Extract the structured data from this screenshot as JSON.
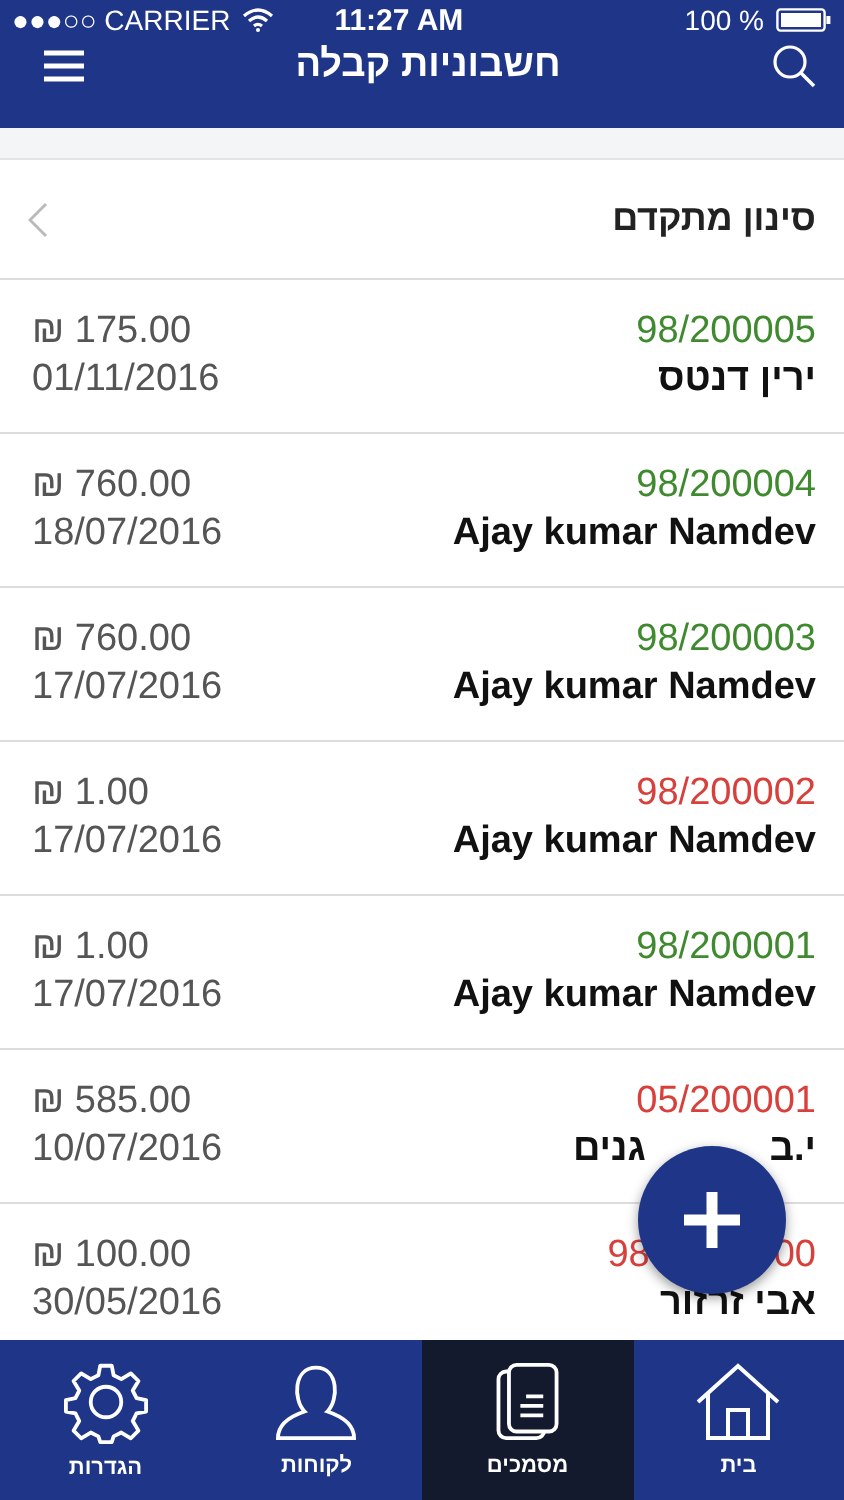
{
  "status_bar": {
    "carrier": "●●●○○ CARRIER",
    "time": "11:27 AM",
    "battery": "100 %"
  },
  "header": {
    "title": "חשבוניות קבלה"
  },
  "filter": {
    "label": "סינון מתקדם"
  },
  "rows": [
    {
      "number_parts": [
        "98/200005"
      ],
      "color": "#3f8a2f",
      "name_parts": [
        "ירין דנטס"
      ],
      "amount": "₪ 175.00",
      "date": "01/11/2016"
    },
    {
      "number_parts": [
        "98/200004"
      ],
      "color": "#3f8a2f",
      "name_parts": [
        "Ajay kumar Namdev"
      ],
      "amount": "₪ 760.00",
      "date": "18/07/2016"
    },
    {
      "number_parts": [
        "98/200003"
      ],
      "color": "#3f8a2f",
      "name_parts": [
        "Ajay kumar Namdev"
      ],
      "amount": "₪ 760.00",
      "date": "17/07/2016"
    },
    {
      "number_parts": [
        "98/200002"
      ],
      "color": "#d8403c",
      "name_parts": [
        "Ajay kumar Namdev"
      ],
      "amount": "₪ 1.00",
      "date": "17/07/2016"
    },
    {
      "number_parts": [
        "98/200001"
      ],
      "color": "#3f8a2f",
      "name_parts": [
        "Ajay kumar Namdev"
      ],
      "amount": "₪ 1.00",
      "date": "17/07/2016"
    },
    {
      "number_parts": [
        "05/200001"
      ],
      "color": "#d8403c",
      "name_parts": [
        "י.ב",
        "גנים"
      ],
      "amount": "₪ 585.00",
      "date": "10/07/2016"
    },
    {
      "number_parts": [
        "98",
        "00"
      ],
      "color": "#d8403c",
      "name_parts": [
        "אבי זרזור"
      ],
      "amount": "₪ 100.00",
      "date": "30/05/2016"
    }
  ],
  "tabs": [
    {
      "label": "בית",
      "selected": false
    },
    {
      "label": "מסמכים",
      "selected": true
    },
    {
      "label": "לקוחות",
      "selected": false
    },
    {
      "label": "הגדרות",
      "selected": false
    }
  ]
}
